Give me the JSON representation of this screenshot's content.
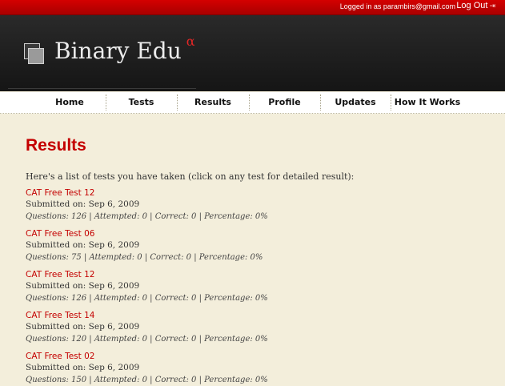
{
  "topbar": {
    "logged_in_text": "Logged in as parambirs@gmail.com",
    "logout_label": "Log Out",
    "logout_icon": "logout-icon"
  },
  "header": {
    "site_name": "Binary Edu",
    "version_mark": "α",
    "logo_icon": "stacked-squares-logo"
  },
  "nav": {
    "items": [
      {
        "label": "Home"
      },
      {
        "label": "Tests"
      },
      {
        "label": "Results"
      },
      {
        "label": "Profile"
      },
      {
        "label": "Updates"
      },
      {
        "label": "How It Works"
      }
    ]
  },
  "main": {
    "title": "Results",
    "intro": "Here's a list of tests you have taken (click on any test for detailed result):",
    "tests": [
      {
        "name": "CAT Free Test 12",
        "submitted": "Submitted on: Sep 6, 2009",
        "stats": "Questions: 126 | Attempted: 0 | Correct: 0 | Percentage: 0%"
      },
      {
        "name": "CAT Free Test 06",
        "submitted": "Submitted on: Sep 6, 2009",
        "stats": "Questions: 75 | Attempted: 0 | Correct: 0 | Percentage: 0%"
      },
      {
        "name": "CAT Free Test 12",
        "submitted": "Submitted on: Sep 6, 2009",
        "stats": "Questions: 126 | Attempted: 0 | Correct: 0 | Percentage: 0%"
      },
      {
        "name": "CAT Free Test 14",
        "submitted": "Submitted on: Sep 6, 2009",
        "stats": "Questions: 120 | Attempted: 0 | Correct: 0 | Percentage: 0%"
      },
      {
        "name": "CAT Free Test 02",
        "submitted": "Submitted on: Sep 6, 2009",
        "stats": "Questions: 150 | Attempted: 0 | Correct: 0 | Percentage: 0%"
      }
    ]
  },
  "colors": {
    "accent_red": "#c40000",
    "topbar_red": "#d40000",
    "header_dark": "#1c1c1c",
    "page_bg": "#f3eedb"
  }
}
